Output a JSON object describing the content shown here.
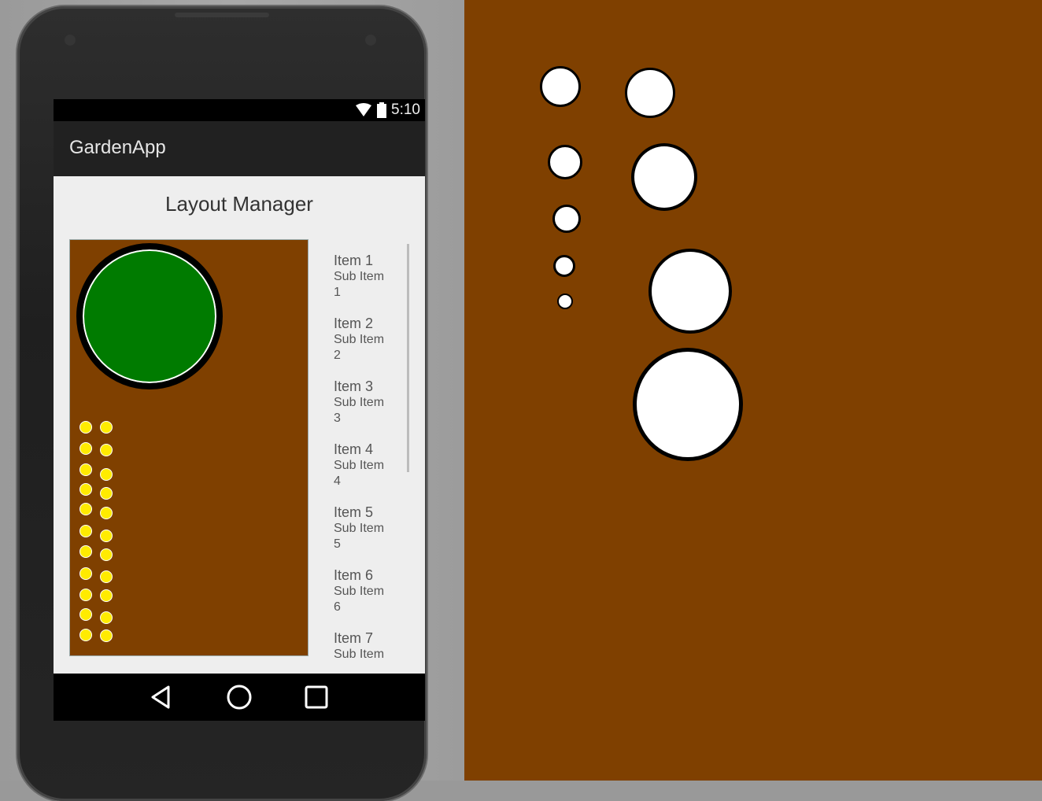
{
  "status_bar": {
    "time": "5:10",
    "icons": [
      "wifi-icon",
      "battery-icon"
    ]
  },
  "app": {
    "title": "GardenApp"
  },
  "page": {
    "title": "Layout Manager"
  },
  "list_items": [
    {
      "title": "Item 1",
      "subtitle": "Sub Item 1"
    },
    {
      "title": "Item 2",
      "subtitle": "Sub Item 2"
    },
    {
      "title": "Item 3",
      "subtitle": "Sub Item 3"
    },
    {
      "title": "Item 4",
      "subtitle": "Sub Item 4"
    },
    {
      "title": "Item 5",
      "subtitle": "Sub Item 5"
    },
    {
      "title": "Item 6",
      "subtitle": "Sub Item 6"
    },
    {
      "title": "Item 7",
      "subtitle": "Sub Item"
    }
  ],
  "nav": {
    "icons": [
      "back-icon",
      "home-icon",
      "recents-icon"
    ]
  },
  "colors": {
    "garden_soil": "#7f4000",
    "big_plant": "#007b00",
    "small_plants": "#ffeb00",
    "right_plants": "#ffffff"
  }
}
